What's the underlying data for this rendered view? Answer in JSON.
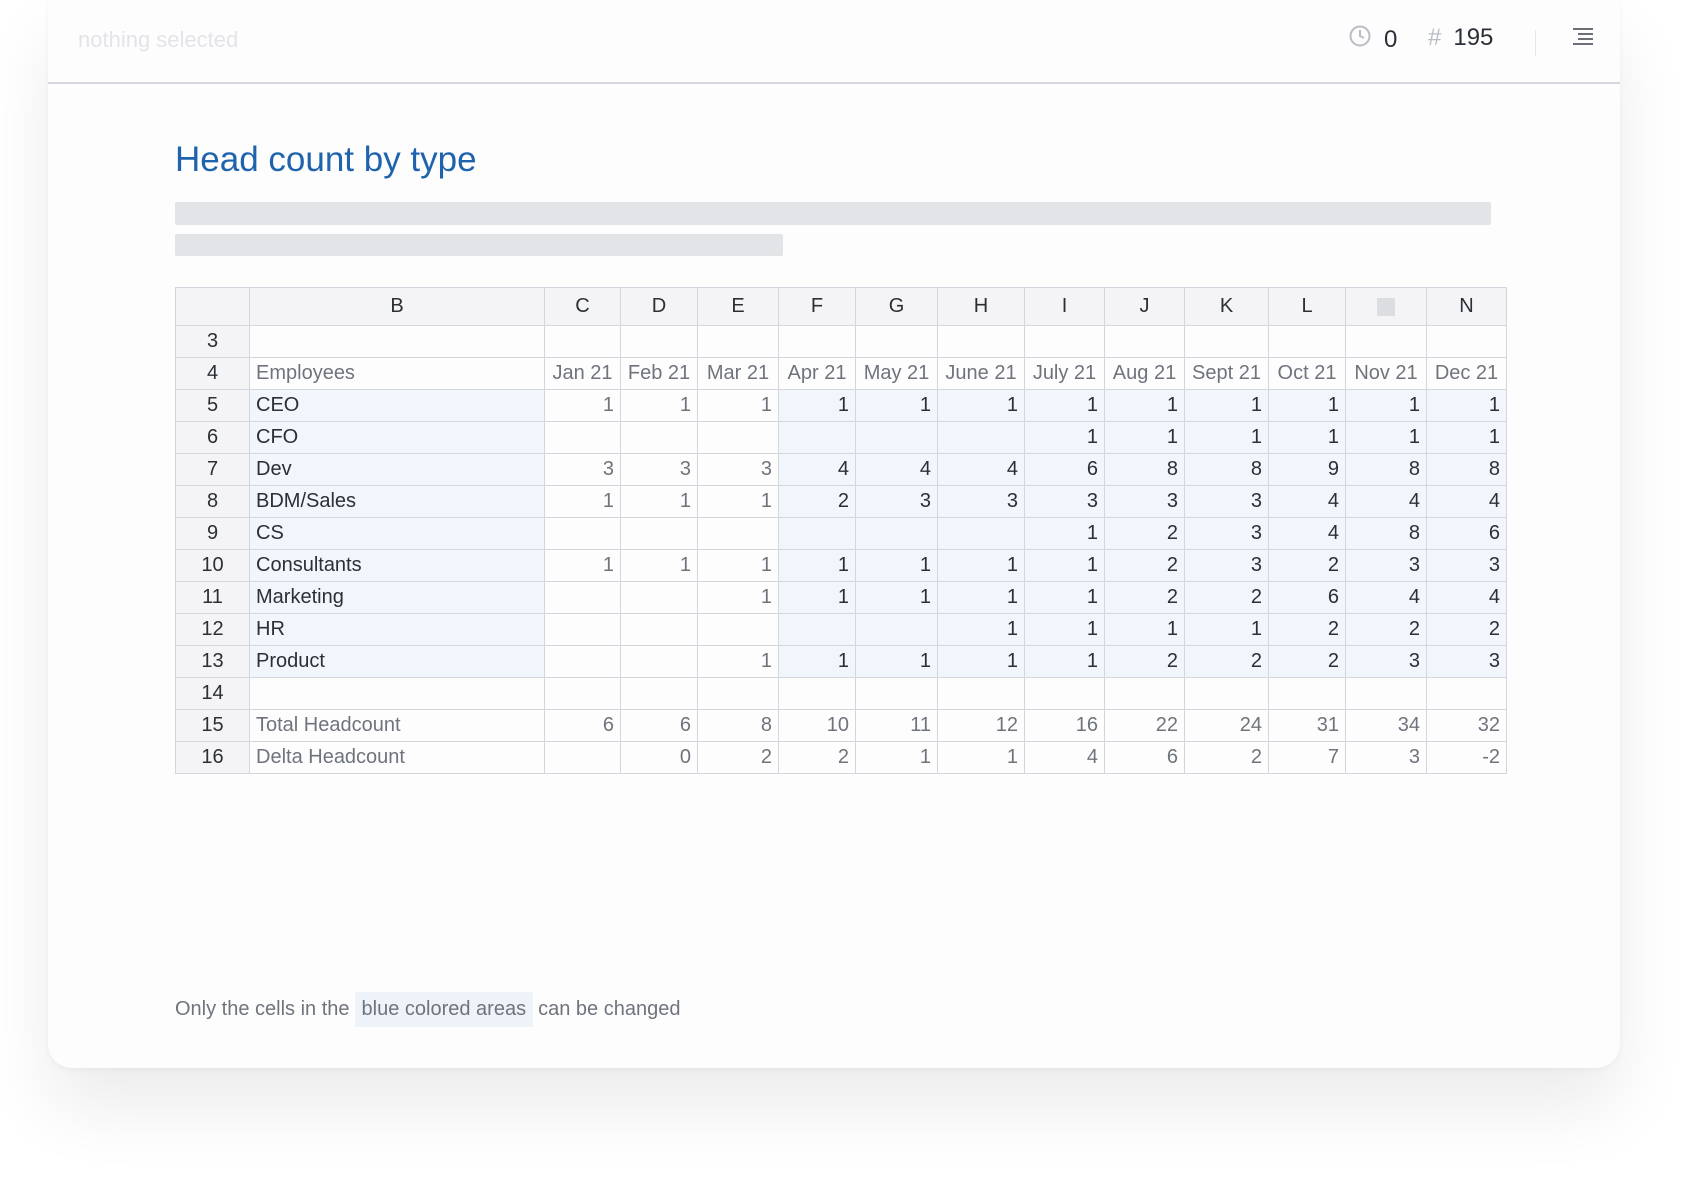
{
  "header": {
    "selection_text": "nothing selected",
    "history_count": "0",
    "cell_count": "195",
    "icons": {
      "history": "clock-icon",
      "count": "hash-icon",
      "menu": "outline-menu-icon"
    }
  },
  "title": "Head count by type",
  "sheet": {
    "columns": [
      "B",
      "C",
      "D",
      "E",
      "F",
      "G",
      "H",
      "I",
      "J",
      "K",
      "L",
      "",
      "N"
    ],
    "rows": [
      {
        "n": "3",
        "label": "",
        "values": [
          "",
          "",
          "",
          "",
          "",
          "",
          "",
          "",
          "",
          "",
          "",
          ""
        ]
      },
      {
        "n": "4",
        "label": "Employees",
        "values": [
          "Jan 21",
          "Feb 21",
          "Mar 21",
          "Apr 21",
          "May 21",
          "June 21",
          "July 21",
          "Aug 21",
          "Sept 21",
          "Oct 21",
          "Nov 21",
          "Dec 21"
        ]
      },
      {
        "n": "5",
        "label": "CEO",
        "values": [
          "1",
          "1",
          "1",
          "1",
          "1",
          "1",
          "1",
          "1",
          "1",
          "1",
          "1",
          "1"
        ]
      },
      {
        "n": "6",
        "label": "CFO",
        "values": [
          "",
          "",
          "",
          "",
          "",
          "",
          "1",
          "1",
          "1",
          "1",
          "1",
          "1"
        ]
      },
      {
        "n": "7",
        "label": "Dev",
        "values": [
          "3",
          "3",
          "3",
          "4",
          "4",
          "4",
          "6",
          "8",
          "8",
          "9",
          "8",
          "8"
        ]
      },
      {
        "n": "8",
        "label": "BDM/Sales",
        "values": [
          "1",
          "1",
          "1",
          "2",
          "3",
          "3",
          "3",
          "3",
          "3",
          "4",
          "4",
          "4"
        ]
      },
      {
        "n": "9",
        "label": "CS",
        "values": [
          "",
          "",
          "",
          "",
          "",
          "",
          "1",
          "2",
          "3",
          "4",
          "8",
          "6"
        ]
      },
      {
        "n": "10",
        "label": "Consultants",
        "values": [
          "1",
          "1",
          "1",
          "1",
          "1",
          "1",
          "1",
          "2",
          "3",
          "2",
          "3",
          "3"
        ]
      },
      {
        "n": "11",
        "label": "Marketing",
        "values": [
          "",
          "",
          "1",
          "1",
          "1",
          "1",
          "1",
          "2",
          "2",
          "6",
          "4",
          "4"
        ]
      },
      {
        "n": "12",
        "label": "HR",
        "values": [
          "",
          "",
          "",
          "",
          "",
          "1",
          "1",
          "1",
          "1",
          "2",
          "2",
          "2"
        ]
      },
      {
        "n": "13",
        "label": "Product",
        "values": [
          "",
          "",
          "1",
          "1",
          "1",
          "1",
          "1",
          "2",
          "2",
          "2",
          "3",
          "3"
        ]
      },
      {
        "n": "14",
        "label": "",
        "values": [
          "",
          "",
          "",
          "",
          "",
          "",
          "",
          "",
          "",
          "",
          "",
          ""
        ]
      },
      {
        "n": "15",
        "label": "Total Headcount",
        "values": [
          "6",
          "6",
          "8",
          "10",
          "11",
          "12",
          "16",
          "22",
          "24",
          "31",
          "34",
          "32"
        ]
      },
      {
        "n": "16",
        "label": "Delta Headcount",
        "values": [
          "",
          "0",
          "2",
          "2",
          "1",
          "1",
          "4",
          "6",
          "2",
          "7",
          "3",
          "-2"
        ]
      }
    ]
  },
  "note": {
    "prefix": "Only the cells in the",
    "highlight": "blue colored areas",
    "suffix": "can be changed"
  },
  "colors": {
    "accent": "#1f63ad",
    "editable_fill": "#f1f5fc",
    "header_fill": "#f4f4f6"
  }
}
